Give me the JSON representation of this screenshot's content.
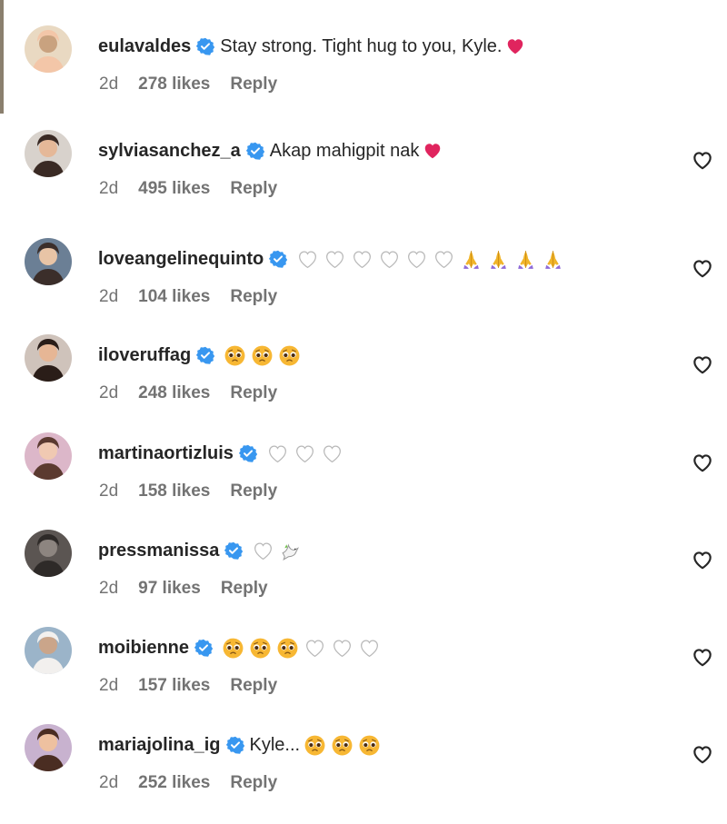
{
  "comments": [
    {
      "username": "eulavaldes",
      "text": "Stay strong. Tight hug to you, Kyle.",
      "emojis": [
        "red-heart"
      ],
      "time": "2d",
      "likes": "278 likes",
      "reply": "Reply",
      "like_button": false
    },
    {
      "username": "sylviasanchez_a",
      "text": "Akap mahigpit nak",
      "emojis": [
        "red-heart"
      ],
      "time": "2d",
      "likes": "495 likes",
      "reply": "Reply",
      "like_button": true
    },
    {
      "username": "loveangelinequinto",
      "text": "",
      "emojis": [
        "white-heart",
        "white-heart",
        "white-heart",
        "white-heart",
        "white-heart",
        "white-heart",
        "folded-hands",
        "folded-hands",
        "folded-hands",
        "folded-hands"
      ],
      "time": "2d",
      "likes": "104 likes",
      "reply": "Reply",
      "like_button": true
    },
    {
      "username": "iloveruffag",
      "text": "",
      "emojis": [
        "pleading-face",
        "pleading-face",
        "pleading-face"
      ],
      "time": "2d",
      "likes": "248 likes",
      "reply": "Reply",
      "like_button": true
    },
    {
      "username": "martinaortizluis",
      "text": "",
      "emojis": [
        "white-heart",
        "white-heart",
        "white-heart"
      ],
      "time": "2d",
      "likes": "158 likes",
      "reply": "Reply",
      "like_button": true
    },
    {
      "username": "pressmanissa",
      "text": "",
      "emojis": [
        "white-heart",
        "dove"
      ],
      "time": "2d",
      "likes": "97 likes",
      "reply": "Reply",
      "like_button": true
    },
    {
      "username": "moibienne",
      "text": "",
      "emojis": [
        "pleading-face",
        "pleading-face",
        "pleading-face",
        "white-heart",
        "white-heart",
        "white-heart"
      ],
      "time": "2d",
      "likes": "157 likes",
      "reply": "Reply",
      "like_button": true
    },
    {
      "username": "mariajolina_ig",
      "text": "Kyle...",
      "emojis": [
        "pleading-face",
        "pleading-face",
        "pleading-face"
      ],
      "time": "2d",
      "likes": "252 likes",
      "reply": "Reply",
      "like_button": true
    }
  ],
  "colors": {
    "verified": "#3897f0",
    "heart_red": "#e0245e",
    "secondary_text": "#737373"
  }
}
